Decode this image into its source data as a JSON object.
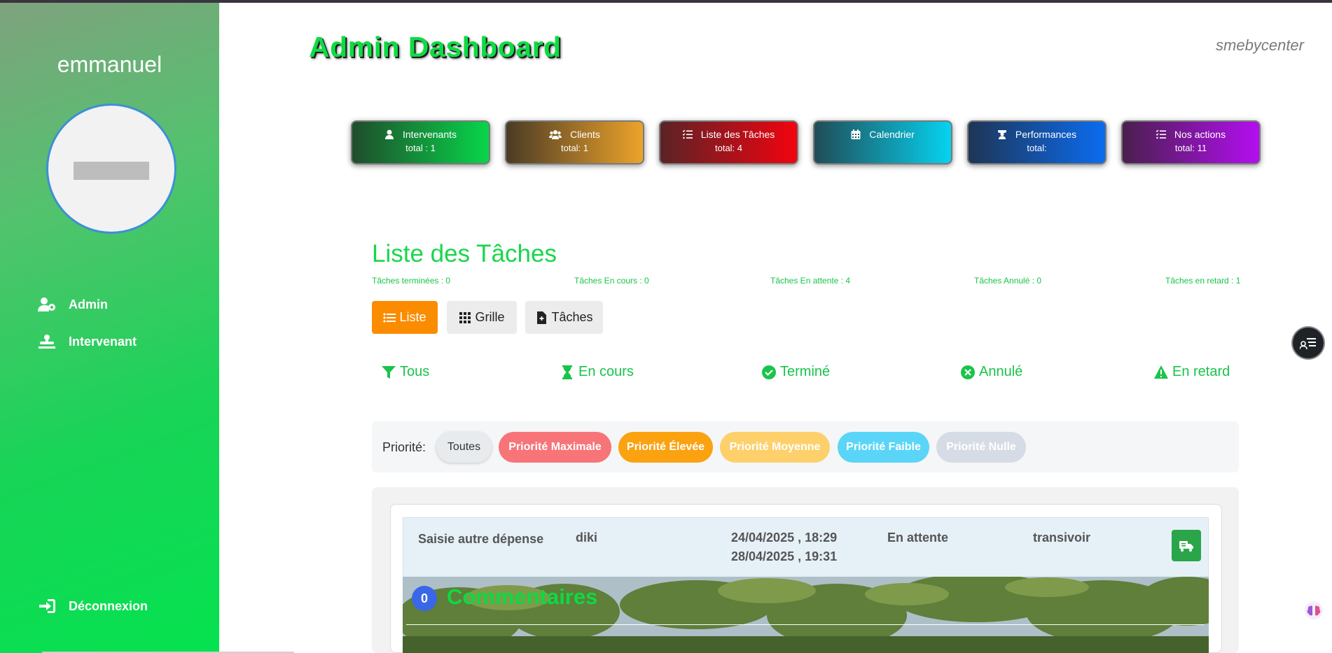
{
  "sidebar": {
    "username": "emmanuel",
    "items": [
      {
        "label": "Admin",
        "icon": "user-gear-icon"
      },
      {
        "label": "Intervenant",
        "icon": "worker-icon"
      }
    ],
    "logout_label": "Déconnexion"
  },
  "header": {
    "title": "Admin Dashboard",
    "brand": "smebycenter"
  },
  "cards": [
    {
      "label": "Intervenants",
      "total": "total : 1",
      "icon": "user-tie-icon",
      "colors": [
        "#1f4d2c",
        "#08d54a"
      ]
    },
    {
      "label": "Clients",
      "total": "total: 1",
      "icon": "users-icon",
      "colors": [
        "#4a3b25",
        "#eda32a"
      ]
    },
    {
      "label": "Liste des Tâches",
      "total": "total: 4",
      "icon": "list-check-icon",
      "colors": [
        "#5a2326",
        "#f2030f"
      ]
    },
    {
      "label": "Calendrier",
      "total": "",
      "icon": "calendar-icon",
      "colors": [
        "#1f4d57",
        "#06d2f0"
      ]
    },
    {
      "label": "Performances",
      "total": "total:",
      "icon": "teacher-icon",
      "colors": [
        "#1e3555",
        "#0b6cf0"
      ]
    },
    {
      "label": "Nos actions",
      "total": "total: 11",
      "icon": "list-check-icon",
      "colors": [
        "#4a1f4e",
        "#b30ef0"
      ]
    }
  ],
  "tasks": {
    "title": "Liste des Tâches",
    "stats": [
      "Tâches terminées : 0",
      "Tâches En cours : 0",
      "Tâches En attente : 4",
      "Tâches Annulé : 0",
      "Tâches en retard : 1"
    ],
    "views": [
      {
        "label": "Liste",
        "icon": "list-icon"
      },
      {
        "label": "Grille",
        "icon": "grid-icon"
      },
      {
        "label": "Tâches",
        "icon": "file-add-icon"
      }
    ],
    "filters": [
      {
        "label": "Tous",
        "icon": "filter-icon"
      },
      {
        "label": "En cours",
        "icon": "hourglass-icon"
      },
      {
        "label": "Terminé",
        "icon": "check-circle-icon"
      },
      {
        "label": "Annulé",
        "icon": "x-circle-icon"
      },
      {
        "label": "En retard",
        "icon": "warning-icon"
      }
    ],
    "priority_label": "Priorité:",
    "priorities": [
      {
        "label": "Toutes",
        "color": "#e8ebee"
      },
      {
        "label": "Priorité Maximale",
        "color": "#f77478"
      },
      {
        "label": "Priorité Élevée",
        "color": "#fba211"
      },
      {
        "label": "Priorité Moyenne",
        "color": "#fdd06b"
      },
      {
        "label": "Priorité Faible",
        "color": "#5ad5f8"
      },
      {
        "label": "Priorité Nulle",
        "color": "#d6dce6"
      }
    ],
    "row": {
      "name": "Saisie autre dépense",
      "client": "diki",
      "date_start": "24/04/2025 , 18:29",
      "date_end": "28/04/2025 , 19:31",
      "status": "En attente",
      "assignee": "transivoir"
    },
    "comments": {
      "count": "0",
      "title": "Commentaires"
    }
  }
}
